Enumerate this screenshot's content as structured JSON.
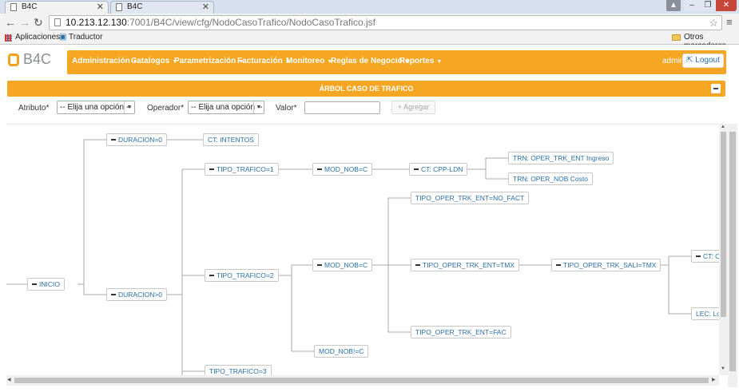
{
  "browser": {
    "tabs": [
      {
        "label": "B4C",
        "active": true
      },
      {
        "label": "B4C",
        "active": false
      }
    ],
    "url_host": "10.213.12.130",
    "url_path": ":7001/B4C/view/cfg/NodoCasoTrafico/NodoCasoTrafico.jsf",
    "bookmarks": {
      "apps": "Aplicaciones",
      "translator": "Traductor",
      "other": "Otros marcadores"
    }
  },
  "app": {
    "logo_text": "B4C",
    "nav": [
      "Administración",
      "Catalogos",
      "Parametrización",
      "Facturación",
      "Monitoreo",
      "Reglas de Negocio",
      "Reportes"
    ],
    "user": "admin",
    "logout": "Logout"
  },
  "panel": {
    "title": "ÁRBOL CASO DE TRAFICO"
  },
  "filters": {
    "atributo_label": "Atributo*",
    "atributo_value": "-- Elija una opción --",
    "operador_label": "Operador*",
    "operador_value": "-- Elija una opción --",
    "valor_label": "Valor*",
    "add_button": "+ Agregar"
  },
  "tree": {
    "nodes": {
      "inicio": "INICIO",
      "dur1": "DURACION=0",
      "dur2": "DURACION>0",
      "ct_intentos": "CT: INTENTOS",
      "tt1": "TIPO_TRAFICO=1",
      "tt2": "TIPO_TRAFICO=2",
      "tt3": "TIPO_TRAFICO=3",
      "modnob1": "MOD_NOB=C",
      "modnob2": "MOD_NOB=C",
      "modnob3": "MOD_NOB!=C",
      "ct_cpp": "CT: CPP-LDN",
      "trn1": "TRN: OPER_TRK_ENT Ingreso",
      "trn2": "TRN: OPER_NOB Costo",
      "opent_nofact": "TIPO_OPER_TRK_ENT=NO_FACT",
      "opent_tmx": "TIPO_OPER_TRK_ENT=TMX",
      "opent_fac": "TIPO_OPER_TRK_ENT=FAC",
      "opsal_tmx": "TIPO_OPER_TRK_SALI=TMX",
      "ct_cl": "CT: Cl",
      "lec": "LEC: Lo"
    }
  }
}
